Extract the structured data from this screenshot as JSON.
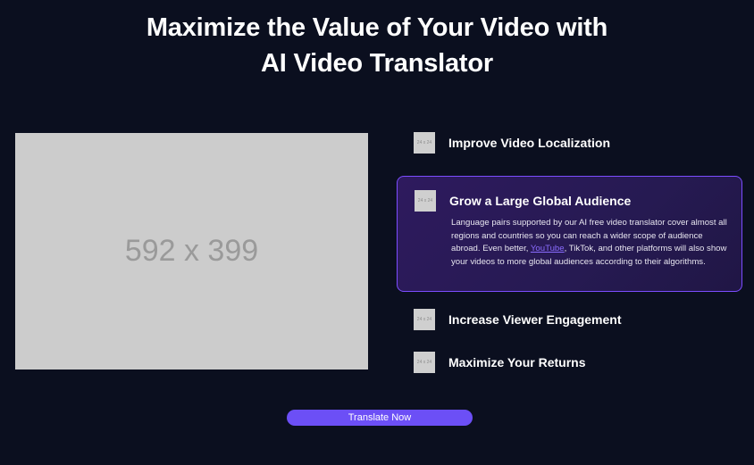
{
  "heading": {
    "line1": "Maximize the Value of Your Video with",
    "line2": "AI Video Translator"
  },
  "media_placeholder": {
    "label": "592 x 399"
  },
  "features": [
    {
      "icon_label": "24 x 24",
      "title": "Improve Video Localization"
    },
    {
      "icon_label": "24 x 24",
      "title": "Grow a Large Global Audience",
      "active": true,
      "description_before_link": "Language pairs supported by our AI free video translator cover almost all regions and countries so you can reach a wider scope of audience abroad. Even better, ",
      "link_text": "YouTube",
      "description_after_link": ", TikTok, and other platforms will also show your videos to more global audiences according to their algorithms."
    },
    {
      "icon_label": "24 x 24",
      "title": "Increase Viewer Engagement"
    },
    {
      "icon_label": "24 x 24",
      "title": "Maximize Your Returns"
    }
  ],
  "cta": {
    "label": "Translate Now"
  },
  "colors": {
    "background": "#0b0f1f",
    "accent": "#6c4ff6",
    "card_border": "#7c4dff",
    "placeholder": "#cccccc"
  }
}
